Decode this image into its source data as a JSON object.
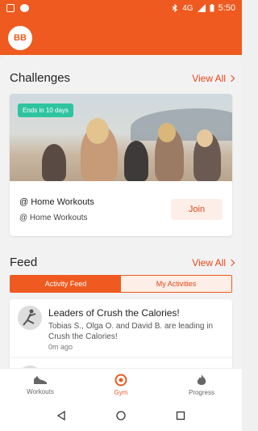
{
  "status_bar": {
    "time": "5:50",
    "network": "4G"
  },
  "app_bar": {
    "avatar_initials": "BB"
  },
  "challenges": {
    "title": "Challenges",
    "view_all": "View All",
    "card": {
      "badge": "Ends in 10 days",
      "name": "@ Home Workouts",
      "subtitle": "@ Home Workouts",
      "join_label": "Join"
    }
  },
  "feed": {
    "title": "Feed",
    "view_all": "View All",
    "tabs": [
      {
        "label": "Activity Feed",
        "active": true
      },
      {
        "label": "My Activities",
        "active": false
      }
    ],
    "items": [
      {
        "title": "Leaders of Crush the Calories!",
        "text": "Tobias S., Olga O. and David B. are leading in Crush the Calories!",
        "time": "0m ago"
      }
    ]
  },
  "bottom_nav": [
    {
      "label": "Workouts",
      "icon": "shoe-icon",
      "active": false
    },
    {
      "label": "Gym",
      "icon": "gym-icon",
      "active": true
    },
    {
      "label": "Progress",
      "icon": "flame-icon",
      "active": false
    }
  ],
  "colors": {
    "accent": "#ee5a1f",
    "badge": "#2ec4a0"
  }
}
